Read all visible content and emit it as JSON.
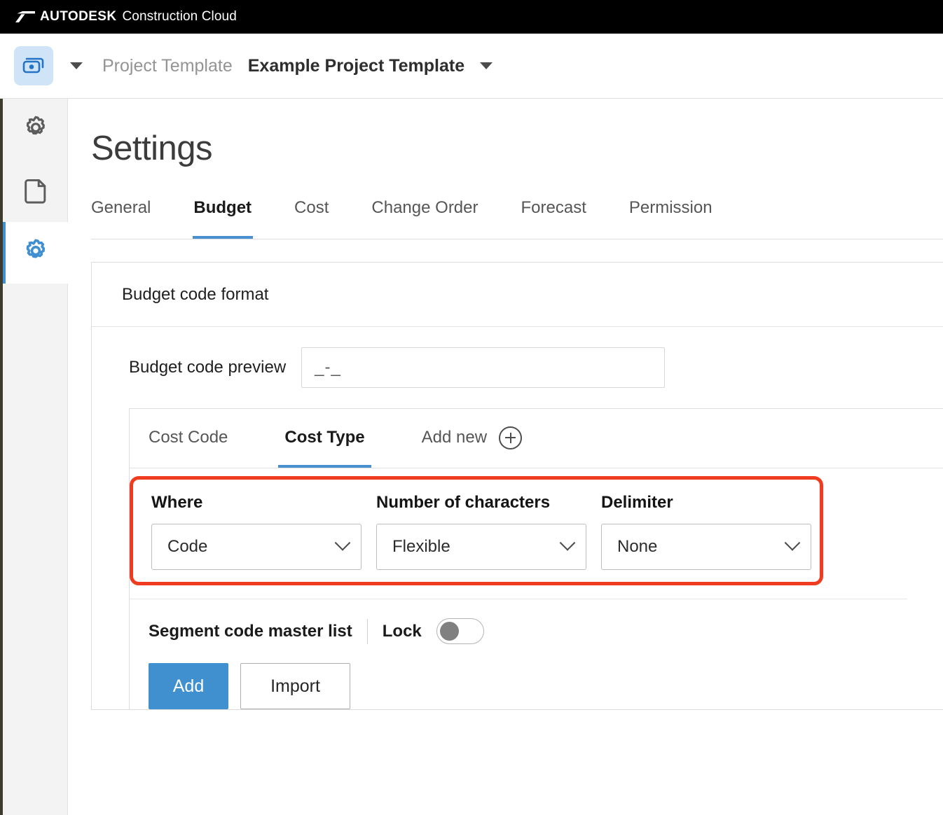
{
  "topbar": {
    "brand": "AUTODESK",
    "product": "Construction Cloud",
    "logo_icon": "autodesk-logo-icon"
  },
  "projectbar": {
    "app_icon": "cost-management-app-icon",
    "app_switcher_caret_icon": "chevron-down-icon",
    "breadcrumb_parent": "Project Template",
    "breadcrumb_current": "Example Project Template",
    "project_caret_icon": "chevron-down-icon"
  },
  "rail": {
    "items": [
      {
        "icon": "gear-icon",
        "name": "settings-gear",
        "active": false
      },
      {
        "icon": "document-icon",
        "name": "document",
        "active": false
      },
      {
        "icon": "gear-icon",
        "name": "project-settings-gear",
        "active": true
      }
    ],
    "active_accent": "#3f8fd1"
  },
  "main": {
    "page_title": "Settings",
    "tabs": [
      {
        "label": "General",
        "active": false
      },
      {
        "label": "Budget",
        "active": true
      },
      {
        "label": "Cost",
        "active": false
      },
      {
        "label": "Change Order",
        "active": false
      },
      {
        "label": "Forecast",
        "active": false
      },
      {
        "label": "Permission",
        "active": false
      }
    ],
    "card": {
      "header_title": "Budget code format",
      "preview": {
        "label": "Budget code preview",
        "value": "_-_",
        "placeholder": ""
      },
      "segment_tabs": [
        {
          "label": "Cost Code",
          "active": false
        },
        {
          "label": "Cost Type",
          "active": true
        }
      ],
      "add_new": {
        "label": "Add new",
        "icon": "plus-circle-icon"
      },
      "highlight": {
        "color": "#ef3c20",
        "fields": [
          {
            "label": "Where",
            "value": "Code",
            "caret_icon": "chevron-down-icon",
            "name": "where-select"
          },
          {
            "label": "Number of characters",
            "value": "Flexible",
            "caret_icon": "chevron-down-icon",
            "name": "number-of-characters-select"
          },
          {
            "label": "Delimiter",
            "value": "None",
            "caret_icon": "chevron-down-icon",
            "name": "delimiter-select"
          }
        ]
      },
      "master_list": {
        "title": "Segment code master list",
        "lock_label": "Lock",
        "lock_on": false
      },
      "buttons": {
        "add": "Add",
        "import": "Import",
        "primary_color": "#4090cf"
      }
    }
  }
}
